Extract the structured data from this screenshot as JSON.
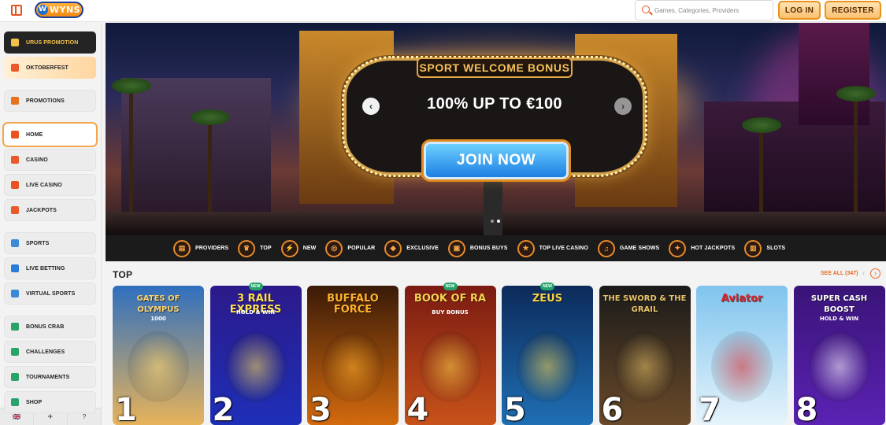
{
  "header": {
    "logo_text": "WYNS",
    "search_placeholder": "Games, Categories, Providers",
    "login_label": "LOG IN",
    "register_label": "REGISTER"
  },
  "sidebar": {
    "items": [
      {
        "label": "URUS PROMOTION",
        "icon": "car-icon",
        "style": "dark"
      },
      {
        "label": "OKTOBERFEST",
        "icon": "beer-icon",
        "style": "promo"
      },
      {
        "label": "PROMOTIONS",
        "icon": "gift-icon",
        "style": "normal"
      },
      {
        "label": "HOME",
        "icon": "home-icon",
        "style": "active"
      },
      {
        "label": "CASINO",
        "icon": "slot-icon",
        "style": "normal"
      },
      {
        "label": "LIVE CASINO",
        "icon": "cards-icon",
        "style": "normal"
      },
      {
        "label": "JACKPOTS",
        "icon": "jackpot-icon",
        "style": "normal"
      },
      {
        "label": "SPORTS",
        "icon": "ball-icon",
        "style": "normal"
      },
      {
        "label": "LIVE BETTING",
        "icon": "live-icon",
        "style": "normal"
      },
      {
        "label": "VIRTUAL SPORTS",
        "icon": "monitor-icon",
        "style": "normal"
      },
      {
        "label": "BONUS CRAB",
        "icon": "crab-icon",
        "style": "normal"
      },
      {
        "label": "CHALLENGES",
        "icon": "medal-icon",
        "style": "normal"
      },
      {
        "label": "TOURNAMENTS",
        "icon": "trophy-icon",
        "style": "normal"
      },
      {
        "label": "SHOP",
        "icon": "shop-icon",
        "style": "normal"
      }
    ]
  },
  "banner": {
    "sign_label": "SPORT WELCOME BONUS",
    "headline": "100% UP TO €100",
    "cta_label": "JOIN NOW",
    "prev_glyph": "‹",
    "next_glyph": "›",
    "slides": 2,
    "active_slide": 2
  },
  "categories": [
    {
      "label": "PROVIDERS",
      "glyph": "▤"
    },
    {
      "label": "TOP",
      "glyph": "♛"
    },
    {
      "label": "NEW",
      "glyph": "⚡"
    },
    {
      "label": "POPULAR",
      "glyph": "◎"
    },
    {
      "label": "EXCLUSIVE",
      "glyph": "◆"
    },
    {
      "label": "BONUS BUYS",
      "glyph": "▣"
    },
    {
      "label": "TOP LIVE CASINO",
      "glyph": "★"
    },
    {
      "label": "GAME SHOWS",
      "glyph": "♫"
    },
    {
      "label": "HOT JACKPOTS",
      "glyph": "✦"
    },
    {
      "label": "SLOTS",
      "glyph": "▥"
    }
  ],
  "top_section": {
    "title": "TOP",
    "see_all": "SEE ALL (347)",
    "prev_glyph": "‹",
    "next_glyph": "›",
    "games": [
      {
        "rank": "1",
        "name": "GATES OF OLYMPUS",
        "sub": "1000",
        "is_new": false,
        "colors": [
          "#2f6fbf",
          "#e7b35a"
        ],
        "title_color": "#ffd56b"
      },
      {
        "rank": "2",
        "name": "3 RAIL EXPRESS",
        "sub": "HOLD & WIN",
        "is_new": true,
        "colors": [
          "#2b1a8a",
          "#1e2fb8"
        ],
        "title_color": "#ffe14d"
      },
      {
        "rank": "3",
        "name": "BUFFALO FORCE",
        "sub": "",
        "is_new": false,
        "colors": [
          "#3a1a08",
          "#d36a0e"
        ],
        "title_color": "#ffb12a"
      },
      {
        "rank": "4",
        "name": "BOOK OF RA",
        "sub": "BUY BONUS",
        "is_new": true,
        "colors": [
          "#7a1a12",
          "#c8531a"
        ],
        "title_color": "#f7d24a"
      },
      {
        "rank": "5",
        "name": "ZEUS",
        "sub": "",
        "is_new": true,
        "colors": [
          "#0c2a5a",
          "#1f6fb4"
        ],
        "title_color": "#f7d24a"
      },
      {
        "rank": "6",
        "name": "THE SWORD & THE GRAIL",
        "sub": "",
        "is_new": false,
        "colors": [
          "#1a1a1a",
          "#6a4a2a"
        ],
        "title_color": "#e9c46a"
      },
      {
        "rank": "7",
        "name": "Aviator",
        "sub": "",
        "is_new": false,
        "colors": [
          "#7fc4ee",
          "#e7f4fb"
        ],
        "title_color": "#d8262b"
      },
      {
        "rank": "8",
        "name": "SUPER CASH BOOST",
        "sub": "HOLD & WIN",
        "is_new": false,
        "colors": [
          "#3a1478",
          "#5b22b4"
        ],
        "title_color": "#ffffff"
      }
    ],
    "new_badge": "NEW"
  },
  "footer_bar": [
    "🇬🇧",
    "✈",
    "?"
  ]
}
